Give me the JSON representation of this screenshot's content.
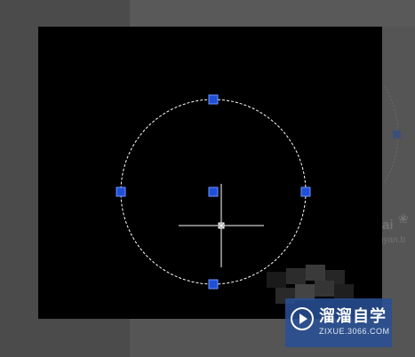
{
  "colors": {
    "canvas_bg": "#000000",
    "grip_fill": "#1f4fd8",
    "grip_stroke": "#6f95ff",
    "circle_stroke": "#ffffff",
    "crosshair": "#ffffff"
  },
  "drawing": {
    "shape": "circle",
    "selected": true,
    "circle_style": "dashed",
    "grips": [
      "top",
      "bottom",
      "left",
      "right",
      "center"
    ]
  },
  "cursor": {
    "type": "crosshair-pickbox"
  },
  "watermark": {
    "icon": "play-circle-icon",
    "title": "溜溜自学",
    "subtitle": "ZIXUE.3066.COM"
  },
  "background_ghost": {
    "fragment1": "ai",
    "fragment2": "gyan.b"
  }
}
